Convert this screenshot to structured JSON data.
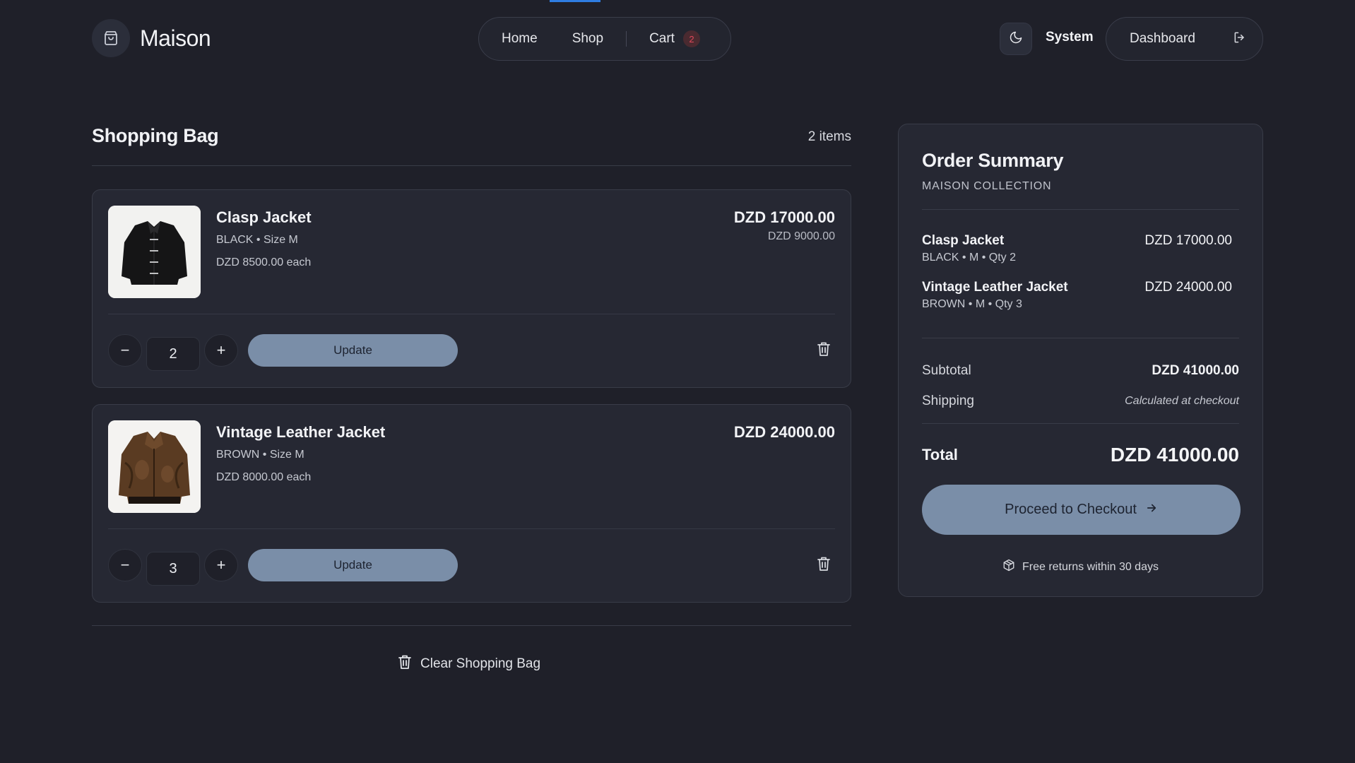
{
  "header": {
    "brand": "Maison",
    "nav": {
      "home": "Home",
      "shop": "Shop",
      "cart": "Cart",
      "cart_count": "2"
    },
    "theme_label": "System",
    "dashboard_label": "Dashboard"
  },
  "bag": {
    "title": "Shopping Bag",
    "count_label": "2 items",
    "items": [
      {
        "name": "Clasp Jacket",
        "variant": "BLACK • Size M",
        "each": "DZD 8500.00 each",
        "total": "DZD 17000.00",
        "compare": "DZD 9000.00",
        "qty": "2",
        "update_label": "Update",
        "image": "black-jacket"
      },
      {
        "name": "Vintage Leather Jacket",
        "variant": "BROWN • Size M",
        "each": "DZD 8000.00 each",
        "total": "DZD 24000.00",
        "qty": "3",
        "update_label": "Update",
        "image": "brown-leather-jacket"
      }
    ],
    "clear_label": "Clear Shopping Bag"
  },
  "summary": {
    "title": "Order Summary",
    "subtitle": "MAISON COLLECTION",
    "items": [
      {
        "name": "Clasp Jacket",
        "meta": "BLACK • M • Qty 2",
        "price": "DZD 17000.00"
      },
      {
        "name": "Vintage Leather Jacket",
        "meta": "BROWN • M • Qty 3",
        "price": "DZD 24000.00"
      }
    ],
    "subtotal_label": "Subtotal",
    "subtotal_value": "DZD 41000.00",
    "shipping_label": "Shipping",
    "shipping_value": "Calculated at checkout",
    "total_label": "Total",
    "total_value": "DZD 41000.00",
    "checkout_label": "Proceed to Checkout",
    "returns_label": "Free returns within 30 days"
  },
  "colors": {
    "background": "#1f2029",
    "card": "#262833",
    "accent_button": "#7a8ea8",
    "badge_text": "#e0485a",
    "top_indicator": "#2f7de1"
  }
}
